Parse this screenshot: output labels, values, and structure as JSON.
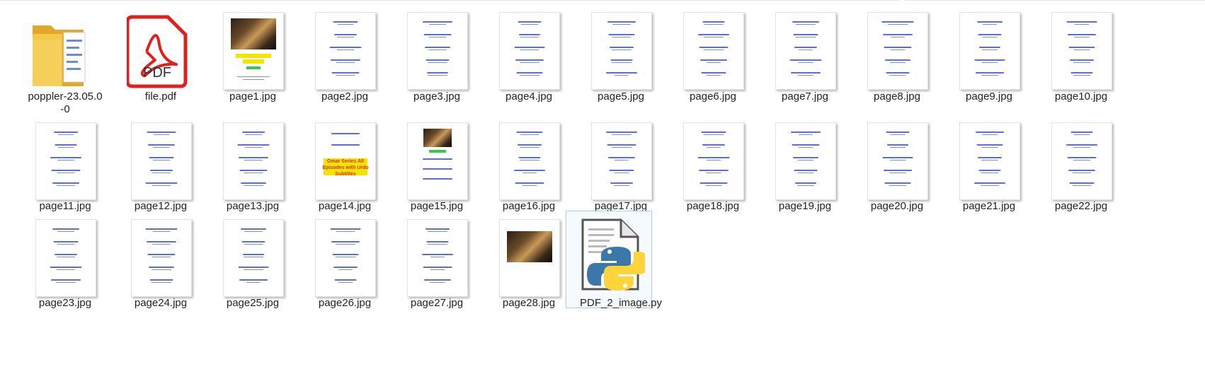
{
  "items": [
    {
      "name": "poppler-23.05.0-0",
      "kind": "folder"
    },
    {
      "name": "file.pdf",
      "kind": "pdf",
      "pdf_badge": "PDF"
    },
    {
      "name": "page1.jpg",
      "kind": "page-image"
    },
    {
      "name": "page2.jpg",
      "kind": "page-text"
    },
    {
      "name": "page3.jpg",
      "kind": "page-text"
    },
    {
      "name": "page4.jpg",
      "kind": "page-text"
    },
    {
      "name": "page5.jpg",
      "kind": "page-text"
    },
    {
      "name": "page6.jpg",
      "kind": "page-text"
    },
    {
      "name": "page7.jpg",
      "kind": "page-text"
    },
    {
      "name": "page8.jpg",
      "kind": "page-text"
    },
    {
      "name": "page9.jpg",
      "kind": "page-text"
    },
    {
      "name": "page10.jpg",
      "kind": "page-text"
    },
    {
      "name": "page11.jpg",
      "kind": "page-text"
    },
    {
      "name": "page12.jpg",
      "kind": "page-text"
    },
    {
      "name": "page13.jpg",
      "kind": "page-text"
    },
    {
      "name": "page14.jpg",
      "kind": "page-title"
    },
    {
      "name": "page15.jpg",
      "kind": "page-image-small"
    },
    {
      "name": "page16.jpg",
      "kind": "page-text"
    },
    {
      "name": "page17.jpg",
      "kind": "page-text"
    },
    {
      "name": "page18.jpg",
      "kind": "page-text"
    },
    {
      "name": "page19.jpg",
      "kind": "page-text"
    },
    {
      "name": "page20.jpg",
      "kind": "page-text"
    },
    {
      "name": "page21.jpg",
      "kind": "page-text"
    },
    {
      "name": "page22.jpg",
      "kind": "page-text"
    },
    {
      "name": "page23.jpg",
      "kind": "page-text"
    },
    {
      "name": "page24.jpg",
      "kind": "page-text"
    },
    {
      "name": "page25.jpg",
      "kind": "page-text"
    },
    {
      "name": "page26.jpg",
      "kind": "page-text"
    },
    {
      "name": "page27.jpg",
      "kind": "page-text"
    },
    {
      "name": "page28.jpg",
      "kind": "page-photo-only"
    },
    {
      "name": "PDF_2_image.py",
      "kind": "python",
      "selected": true
    }
  ],
  "page14_thumb_text": "Omar Series All Episodes with Urdu Subtitles",
  "colors": {
    "link_blue": "#5a6fd6",
    "pdf_red": "#e0201b",
    "folder_yellow": "#f4c84a",
    "selection_bg": "#f5faff",
    "selection_border": "#a9cdee"
  }
}
